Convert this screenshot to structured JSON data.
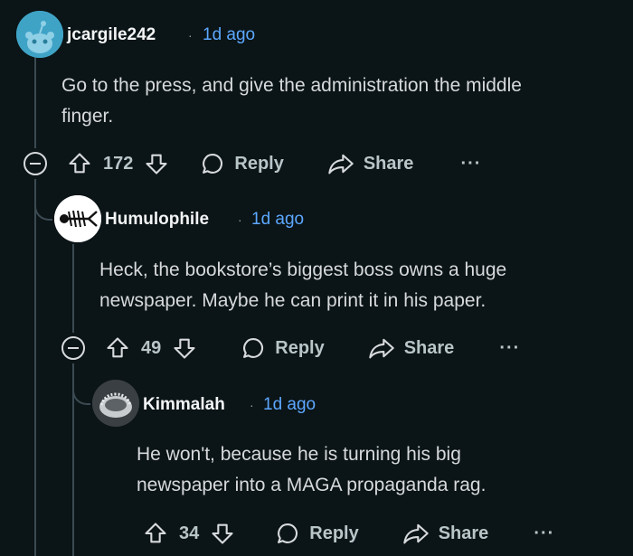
{
  "comments": [
    {
      "author": "jcargile242",
      "time": "1d ago",
      "text_lines": [
        "Go to the press, and give the administration the middle",
        "finger."
      ],
      "votes": "172",
      "reply_label": "Reply",
      "share_label": "Share",
      "more_label": "···"
    },
    {
      "author": "Humulophile",
      "time": "1d ago",
      "text_lines": [
        "Heck, the bookstore’s biggest boss owns a huge",
        "newspaper. Maybe he can print it in his paper."
      ],
      "votes": "49",
      "reply_label": "Reply",
      "share_label": "Share",
      "more_label": "···"
    },
    {
      "author": "Kimmalah",
      "time": "1d ago",
      "text_lines": [
        "He won't, because he is turning his big",
        "newspaper into a MAGA propaganda rag."
      ],
      "votes": "34",
      "reply_label": "Reply",
      "share_label": "Share",
      "more_label": "···"
    }
  ],
  "separator": "·",
  "colors": {
    "background": "#0b1416",
    "timestamp": "#5ca8ff",
    "thread_line": "#3b4a52"
  }
}
